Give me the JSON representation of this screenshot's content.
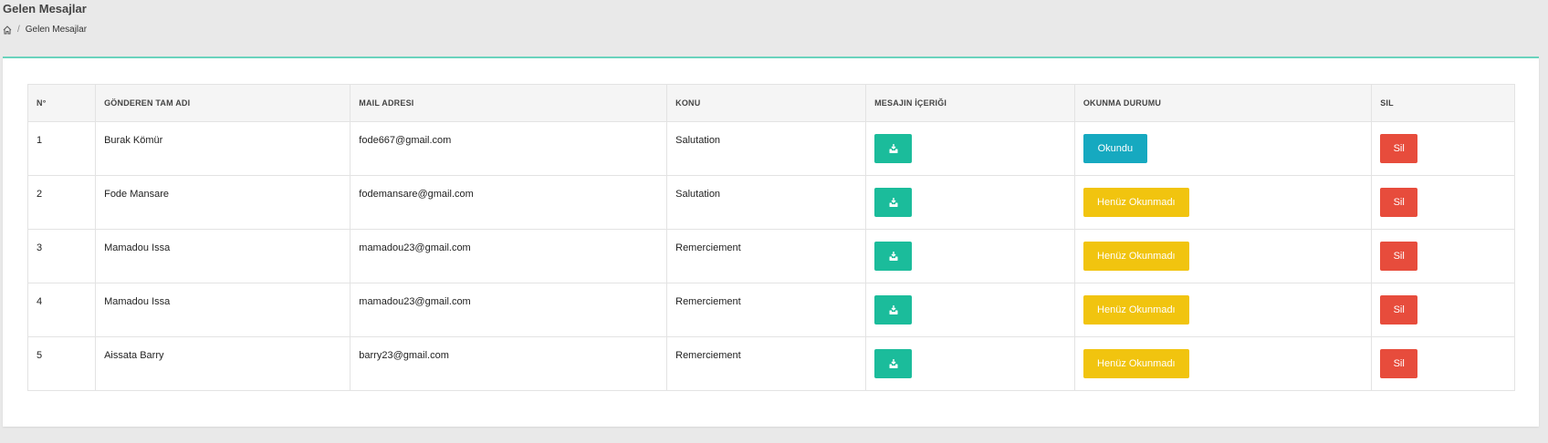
{
  "page": {
    "title": "Gelen Mesajlar"
  },
  "breadcrumb": {
    "home_icon": "home-icon",
    "current": "Gelen Mesajlar",
    "separator": "/"
  },
  "colors": {
    "content_button": "#1bbc9b",
    "read_button": "#16a9c0",
    "unread_button": "#f1c40f",
    "delete_button": "#e74c3c",
    "panel_accent": "#6ad3bd"
  },
  "table": {
    "headers": [
      "N°",
      "GÖNDEREN TAM ADI",
      "MAIL ADRESI",
      "KONU",
      "MESAJIN İÇERIĞI",
      "OKUNMA DURUMU",
      "SIL"
    ],
    "rows": [
      {
        "no": "1",
        "name": "Burak Kömür",
        "email": "fode667@gmail.com",
        "subject": "Salutation",
        "content_icon": "inbox-icon",
        "status": "Okundu",
        "status_type": "read",
        "delete": "Sil"
      },
      {
        "no": "2",
        "name": "Fode Mansare",
        "email": "fodemansare@gmail.com",
        "subject": "Salutation",
        "content_icon": "inbox-icon",
        "status": "Henüz Okunmadı",
        "status_type": "unread",
        "delete": "Sil"
      },
      {
        "no": "3",
        "name": "Mamadou Issa",
        "email": "mamadou23@gmail.com",
        "subject": "Remerciement",
        "content_icon": "inbox-icon",
        "status": "Henüz Okunmadı",
        "status_type": "unread",
        "delete": "Sil"
      },
      {
        "no": "4",
        "name": "Mamadou Issa",
        "email": "mamadou23@gmail.com",
        "subject": "Remerciement",
        "content_icon": "inbox-icon",
        "status": "Henüz Okunmadı",
        "status_type": "unread",
        "delete": "Sil"
      },
      {
        "no": "5",
        "name": "Aissata Barry",
        "email": "barry23@gmail.com",
        "subject": "Remerciement",
        "content_icon": "inbox-icon",
        "status": "Henüz Okunmadı",
        "status_type": "unread",
        "delete": "Sil"
      }
    ]
  }
}
